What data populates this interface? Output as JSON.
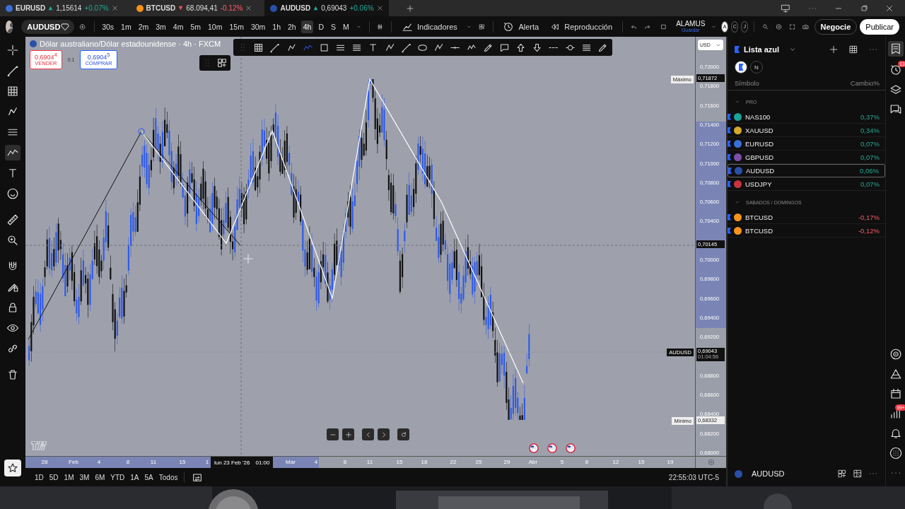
{
  "tabs": [
    {
      "symbol": "EURUSD",
      "price": "1,15614",
      "change": "+0.07%",
      "rising": true,
      "color": "#3b6fd8",
      "selected": false
    },
    {
      "symbol": "BTCUSD",
      "price": "68.094,41",
      "change": "-0.12%",
      "rising": false,
      "color": "#f7931a",
      "selected": false
    },
    {
      "symbol": "AUDUSD",
      "price": "0,69043",
      "change": "+0.06%",
      "rising": true,
      "color": "#2a4fa8",
      "selected": true
    }
  ],
  "toolbar": {
    "symbol": "AUDUSD",
    "intervals": [
      {
        "label": "30s",
        "selected": false
      },
      {
        "label": "1m",
        "selected": false
      },
      {
        "label": "2m",
        "selected": false
      },
      {
        "label": "3m",
        "selected": false
      },
      {
        "label": "4m",
        "selected": false
      },
      {
        "label": "5m",
        "selected": false
      },
      {
        "label": "10m",
        "selected": false
      },
      {
        "label": "15m",
        "selected": false
      },
      {
        "label": "30m",
        "selected": false
      },
      {
        "label": "1h",
        "selected": false
      },
      {
        "label": "2h",
        "selected": false
      },
      {
        "label": "4h",
        "selected": true
      },
      {
        "label": "D",
        "selected": false
      },
      {
        "label": "S",
        "selected": false
      },
      {
        "label": "M",
        "selected": false
      }
    ],
    "indicators": "Indicadores",
    "alert": "Alerta",
    "replay": "Reproducción",
    "layout_name": "ALAMUS",
    "save": "Guardar",
    "users": [
      "A",
      "C",
      "J"
    ],
    "trade": "Negocie",
    "publish": "Publicar"
  },
  "chart": {
    "title": "Dólar australiano/Dólar estadounidense · 4h · FXCM",
    "sell": {
      "price": "0,6904$^{4}$",
      "label": "VENDER"
    },
    "spread": "0.1",
    "buy": {
      "price": "0,6904$^{5}$",
      "label": "COMPRAR"
    },
    "currency": "USD",
    "price_ticks": [
      "0,72000",
      "0,71800",
      "0,71600",
      "0,71400",
      "0,71200",
      "0,71000",
      "0,70800",
      "0,70600",
      "0,70400",
      "0,70000",
      "0,69800",
      "0,69600",
      "0,69400",
      "0,69200",
      "0,68800",
      "0,68600",
      "0,68400",
      "0,68200",
      "0,68000"
    ],
    "max": {
      "label": "Máximo",
      "value": "0,71872"
    },
    "crosshair_price": "0,70145",
    "last": {
      "symbol": "AUDUSD",
      "price": "0,69043",
      "countdown": "01:04:56"
    },
    "min": {
      "label": "Mínimo",
      "value": "0,68332"
    },
    "date_ticks": [
      "28",
      "Feb",
      "4",
      "8",
      "11",
      "15",
      "1",
      "Mar",
      "4",
      "8",
      "11",
      "15",
      "18",
      "22",
      "25",
      "29",
      "Abr",
      "5",
      "8",
      "12",
      "15",
      "19"
    ],
    "crosshair_date": "lun 23 Feb '26",
    "crosshair_time": "01:00"
  },
  "ranges": [
    "1D",
    "5D",
    "1M",
    "3M",
    "6M",
    "YTD",
    "1A",
    "5A",
    "Todos"
  ],
  "clock": "22:55:03 UTC-5",
  "watchlist": {
    "title": "Lista azul",
    "filter": "N",
    "col_symbol": "Símbolo",
    "col_change": "Cambio%",
    "groups": [
      {
        "name": "PRO",
        "items": [
          {
            "symbol": "NAS100",
            "change": "0,37%",
            "rising": true,
            "color": "#1aa39a",
            "selected": false
          },
          {
            "symbol": "XAUUSD",
            "change": "0,34%",
            "rising": true,
            "color": "#d4a82a",
            "selected": false
          },
          {
            "symbol": "EURUSD",
            "change": "0,07%",
            "rising": true,
            "color": "#3b6fd8",
            "selected": false
          },
          {
            "symbol": "GBPUSD",
            "change": "0,07%",
            "rising": true,
            "color": "#7b4fa8",
            "selected": false
          },
          {
            "symbol": "AUDUSD",
            "change": "0,06%",
            "rising": true,
            "color": "#2a4fa8",
            "selected": true
          },
          {
            "symbol": "USDJPY",
            "change": "0,07%",
            "rising": true,
            "color": "#c8333c",
            "selected": false
          }
        ]
      },
      {
        "name": "SABADOS / DOMINGOS",
        "items": [
          {
            "symbol": "BTCUSD",
            "change": "-0,17%",
            "rising": false,
            "color": "#f7931a",
            "selected": false
          },
          {
            "symbol": "BTCUSD",
            "change": "-0,12%",
            "rising": false,
            "color": "#f7931a",
            "selected": false
          }
        ]
      }
    ],
    "footer_symbol": "AUDUSD"
  },
  "side_badges": {
    "alerts": "13",
    "notifications": "99+"
  }
}
